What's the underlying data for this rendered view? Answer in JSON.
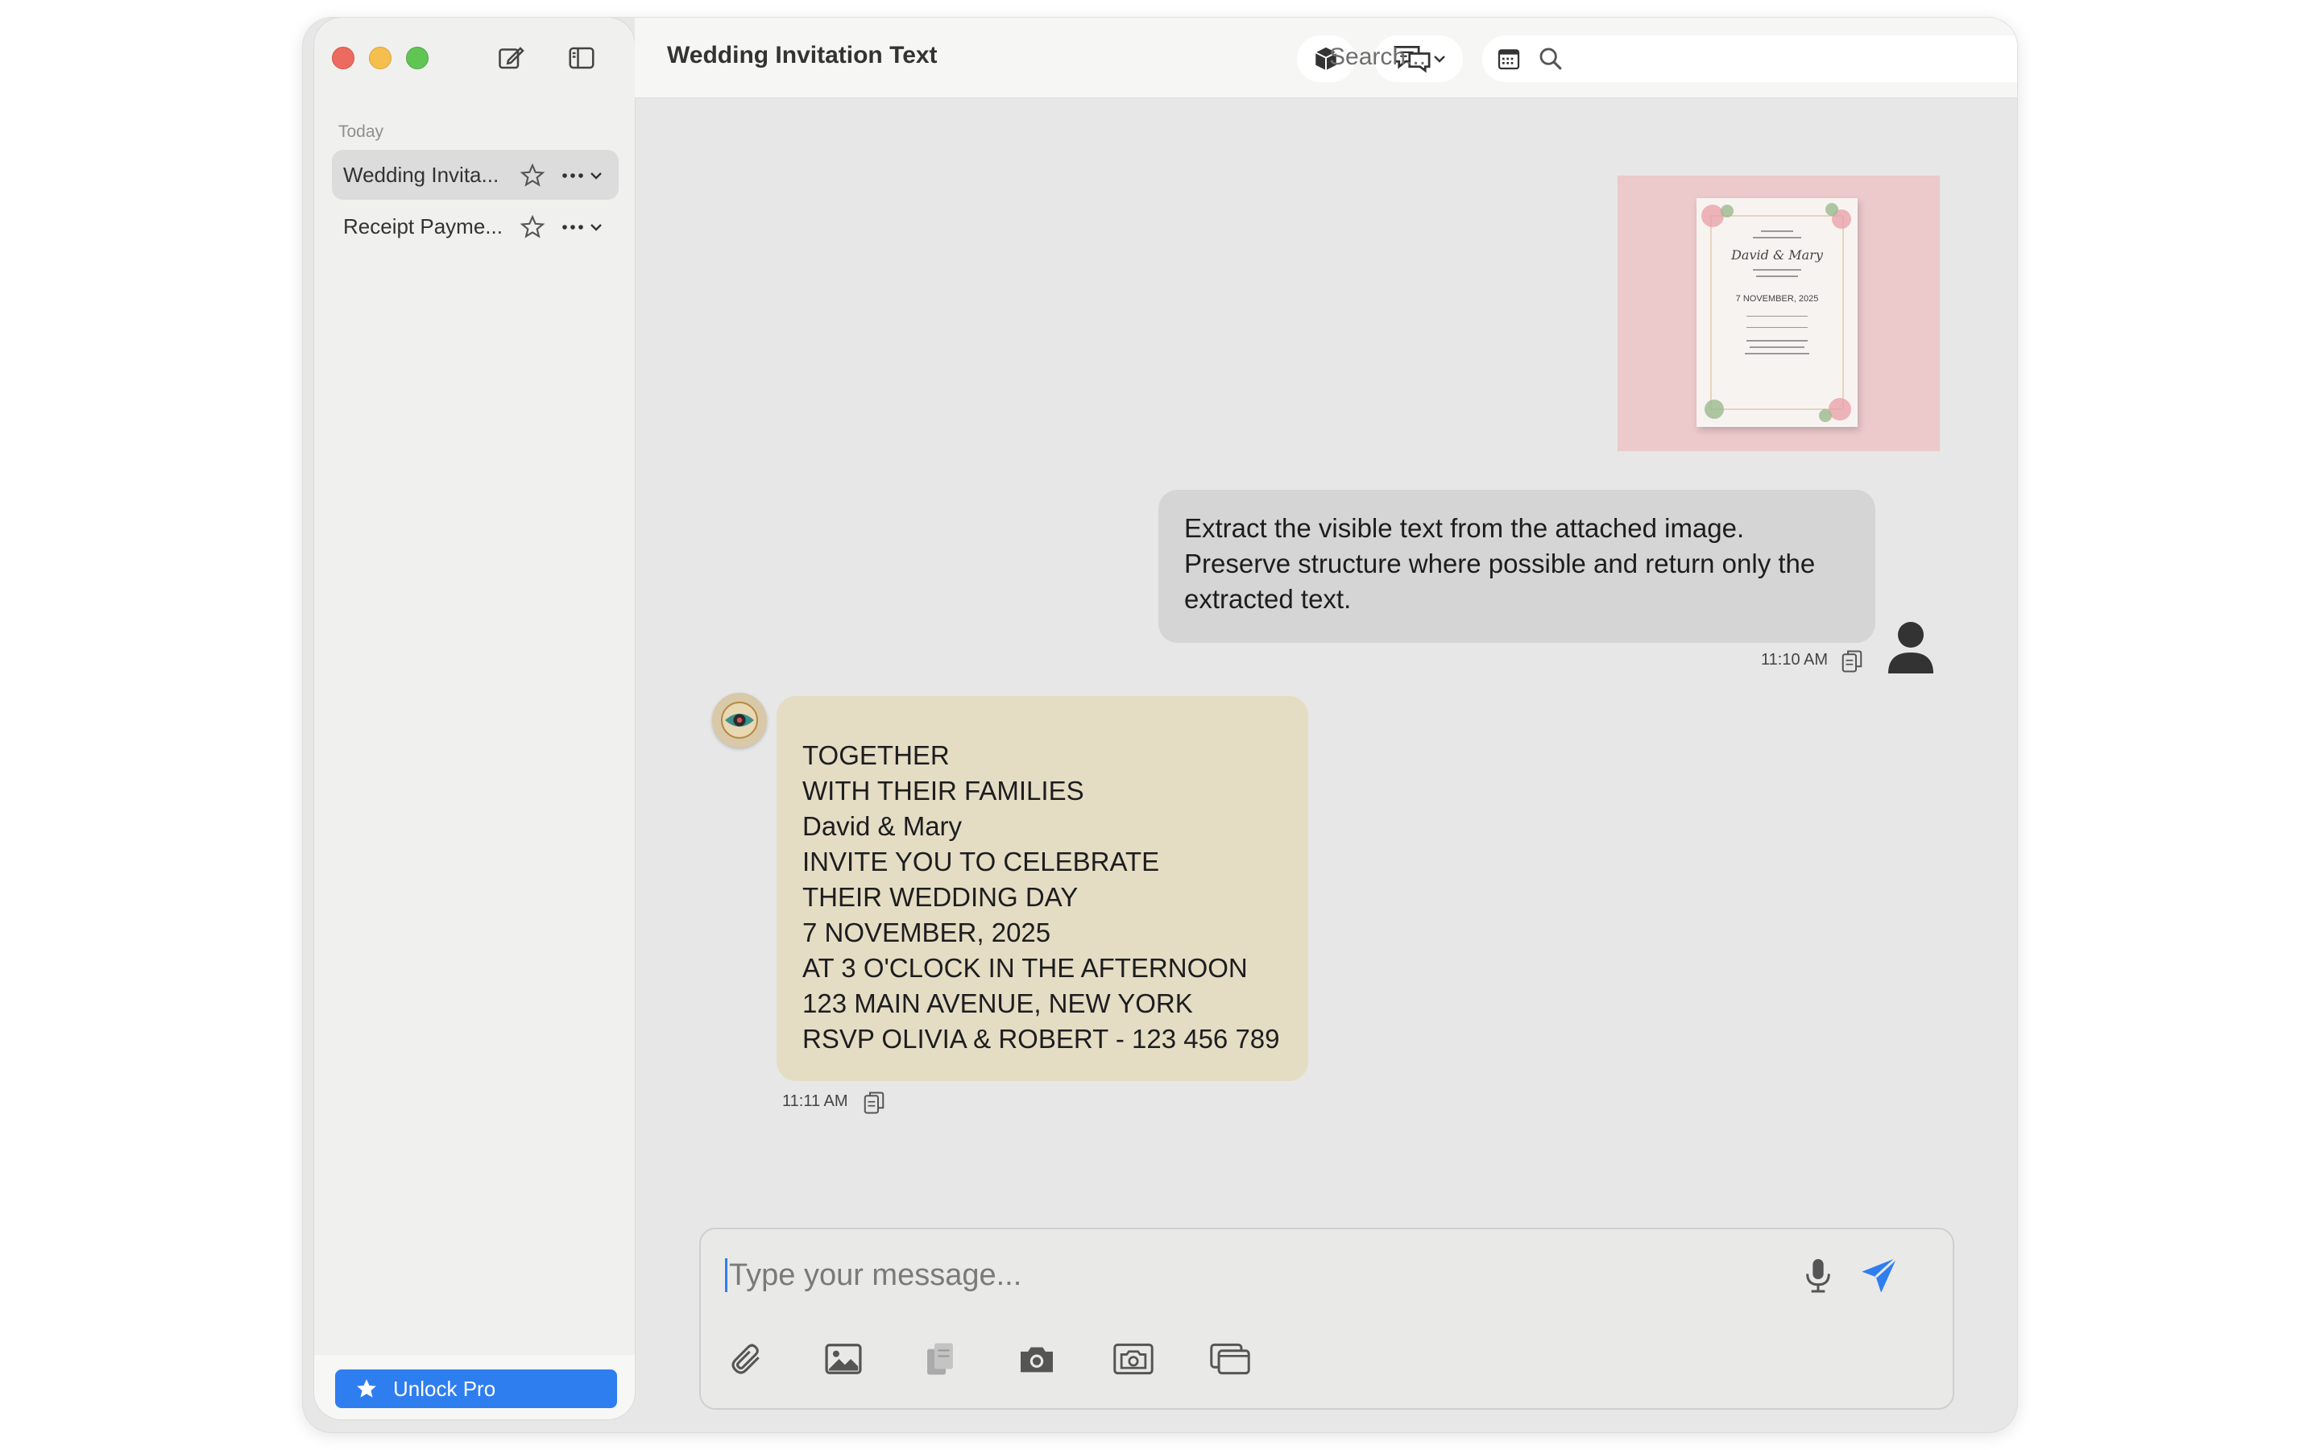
{
  "window": {
    "title": "Wedding Invitation Text"
  },
  "sidebar": {
    "section": "Today",
    "items": [
      {
        "label": "Wedding Invita..."
      },
      {
        "label": "Receipt Payme..."
      }
    ],
    "unlock_label": "Unlock Pro"
  },
  "toolbar": {
    "search_placeholder": "Search..."
  },
  "attachment": {
    "card_lines": [
      "David & Mary",
      "7 NOVEMBER, 2025"
    ]
  },
  "messages": {
    "user": {
      "text": "Extract the visible text from the attached image. Preserve structure where possible and return only the extracted text.",
      "time": "11:10 AM"
    },
    "assistant": {
      "lines": [
        "TOGETHER",
        "WITH THEIR FAMILIES",
        "David & Mary",
        "INVITE YOU TO CELEBRATE",
        "THEIR WEDDING DAY",
        "7 NOVEMBER, 2025",
        "AT 3 O'CLOCK IN THE AFTERNOON",
        "123 MAIN AVENUE, NEW YORK",
        "RSVP OLIVIA & ROBERT - 123 456 789"
      ],
      "time": "11:11 AM"
    }
  },
  "composer": {
    "placeholder": "Type your message..."
  },
  "colors": {
    "accent": "#2f7ef0",
    "user_bubble": "#d5d5d5",
    "assistant_bubble": "#e4ddc4",
    "close": "#ed6a5e",
    "minimize": "#f5bf4f",
    "zoom": "#61c554"
  },
  "icons": {
    "sidebar": [
      "new-chat-icon",
      "sidebar-toggle-icon",
      "star-icon",
      "more-icon",
      "chevron-down-icon"
    ],
    "toolbar": [
      "model-cube-icon",
      "chat-mode-icon",
      "calendar-icon",
      "search-icon",
      "chevron-up-icon",
      "chevron-down-icon",
      "speaker-icon",
      "mute-icon",
      "gear-icon",
      "double-chevron-right-icon"
    ],
    "composer": [
      "paperclip-icon",
      "image-icon",
      "documents-icon",
      "camera-icon",
      "screenshot-camera-icon",
      "window-icon",
      "microphone-icon",
      "send-icon"
    ]
  }
}
